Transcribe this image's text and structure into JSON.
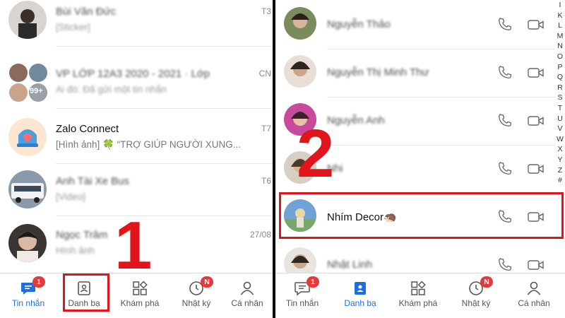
{
  "left": {
    "chats": [
      {
        "name": "Bùi Văn Đức",
        "preview": "[Sticker]",
        "time": "T3",
        "blurred": true
      },
      {
        "name": "VP LỚP 12A3 2020 - 2021 · Lớp",
        "preview": "Ai đó: Đã gửi một tin nhắn",
        "time": "CN",
        "blurred": true,
        "avatar_count": "99+"
      },
      {
        "name": "Zalo Connect",
        "preview": "[Hình ảnh] 🍀 “TRỢ GIÚP NGƯỜI XUNG...",
        "time": "T7",
        "blurred": false
      },
      {
        "name": "Anh Tài Xe Bus",
        "preview": "[Video]",
        "time": "T6",
        "blurred": true
      },
      {
        "name": "Ngọc Trâm",
        "preview": "Hình ảnh",
        "time": "27/08",
        "blurred": true
      }
    ],
    "nav": [
      {
        "label": "Tin nhắn",
        "icon": "chat-icon",
        "badge": "1",
        "active": true
      },
      {
        "label": "Danh bạ",
        "icon": "contacts-icon",
        "badge": "",
        "active": false
      },
      {
        "label": "Khám phá",
        "icon": "grid-icon",
        "badge": "",
        "active": false
      },
      {
        "label": "Nhật ký",
        "icon": "clock-icon",
        "badge": "N",
        "active": false
      },
      {
        "label": "Cá nhân",
        "icon": "person-icon",
        "badge": "",
        "active": false
      }
    ]
  },
  "right": {
    "contacts": [
      {
        "name": "Nguyễn Thảo",
        "blurred": true
      },
      {
        "name": "Nguyễn Thị Minh Thư",
        "blurred": true
      },
      {
        "name": "Nguyễn Anh",
        "blurred": true
      },
      {
        "name": "Nhi",
        "blurred": true
      },
      {
        "name": "Nhím Decor🦔",
        "blurred": false,
        "highlighted": true
      },
      {
        "name": "Nhật Linh",
        "blurred": true
      }
    ],
    "alphabet": [
      "I",
      "K",
      "L",
      "M",
      "N",
      "O",
      "P",
      "Q",
      "R",
      "S",
      "T",
      "U",
      "V",
      "W",
      "X",
      "Y",
      "Z",
      "#"
    ],
    "nav": [
      {
        "label": "Tin nhắn",
        "icon": "chat-icon",
        "badge": "1",
        "active": false
      },
      {
        "label": "Danh bạ",
        "icon": "contacts-icon",
        "badge": "",
        "active": true
      },
      {
        "label": "Khám phá",
        "icon": "grid-icon",
        "badge": "",
        "active": false
      },
      {
        "label": "Nhật ký",
        "icon": "clock-icon",
        "badge": "N",
        "active": false
      },
      {
        "label": "Cá nhân",
        "icon": "person-icon",
        "badge": "",
        "active": false
      }
    ]
  },
  "annotations": {
    "step1": "1",
    "step2": "2"
  },
  "colors": {
    "accent": "#1d6fdd",
    "badge": "#e5393b",
    "highlight": "#e1141a"
  }
}
